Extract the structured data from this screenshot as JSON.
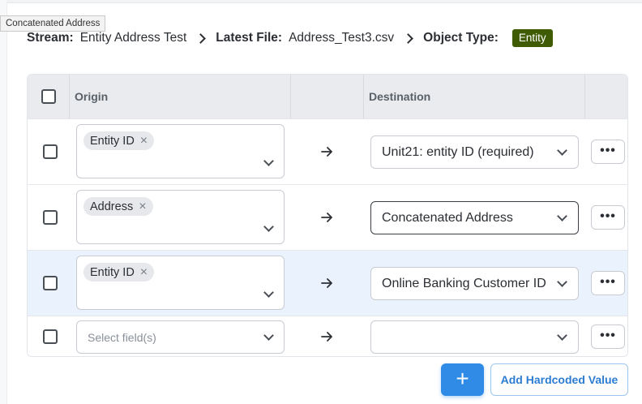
{
  "tooltip": "Concatenated Address",
  "header": {
    "stream_label": "Stream:",
    "stream_value": "Entity Address Test",
    "file_label": "Latest File:",
    "file_value": "Address_Test3.csv",
    "type_label": "Object Type:",
    "type_badge": "Entity",
    "badge_color": "#3f5c05"
  },
  "table": {
    "columns": {
      "origin": "Origin",
      "destination": "Destination"
    },
    "rows": [
      {
        "origin_chip": "Entity ID",
        "destination": "Unit21: entity ID (required)",
        "more": "•••"
      },
      {
        "origin_chip": "Address",
        "destination": "Concatenated Address",
        "more": "•••"
      },
      {
        "origin_chip": "Entity ID",
        "destination": "Online Banking Customer ID",
        "more": "•••"
      },
      {
        "origin_placeholder": "Select field(s)",
        "destination": "",
        "more": "•••"
      }
    ]
  },
  "actions": {
    "add_label": "+",
    "hardcoded_label": "Add Hardcoded Value",
    "accent_color": "#2f8be6"
  }
}
